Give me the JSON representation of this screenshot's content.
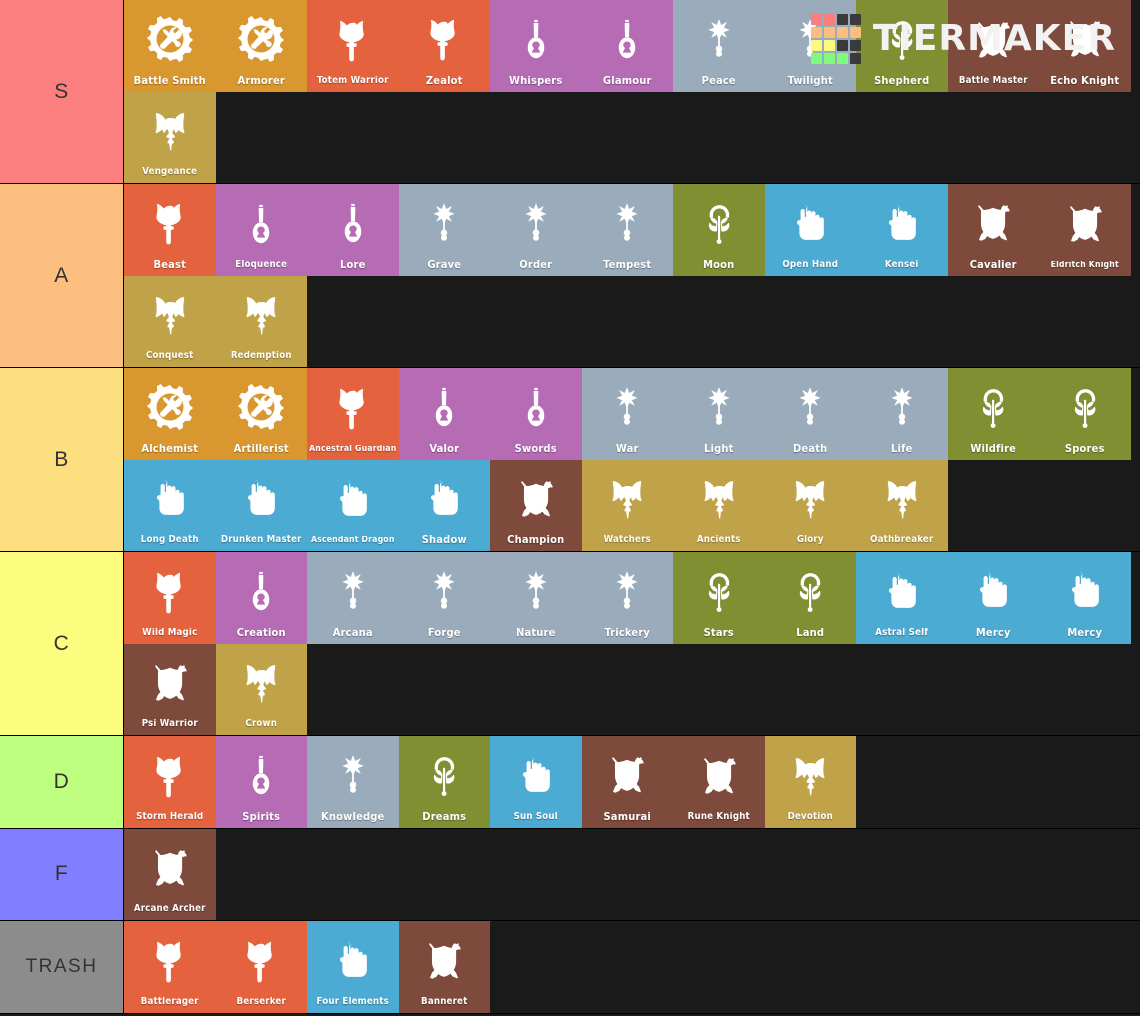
{
  "app": {
    "name": "TierMaker",
    "logo_wordmark": "TIERMAKER",
    "logo_colors": [
      "#fa7e7e",
      "#fa7e7e",
      "#3a3a3a",
      "#3a3a3a",
      "#fcbe7e",
      "#fcbe7e",
      "#fcbe7e",
      "#fcbe7e",
      "#fafa7e",
      "#fafa7e",
      "#3a3a3a",
      "#3a3a3a",
      "#7efa7e",
      "#7efa7e",
      "#7efa7e",
      "#3a3a3a"
    ]
  },
  "palette": {
    "artificer": "#d9972f",
    "barbarian": "#e4633e",
    "bard": "#b56cb5",
    "cleric": "#9aacbc",
    "druid": "#7f8f32",
    "monk": "#4cabd2",
    "fighter": "#7d4a3b",
    "paladin": "#c0a348",
    "tier_s": "#fc7f7f",
    "tier_a": "#fcbf7f",
    "tier_b": "#fcdf7f",
    "tier_c": "#fcfc7f",
    "tier_d": "#bfff7f",
    "tier_f": "#7f7fff",
    "tier_trash": "#8c8c8c",
    "background": "#1a1a1a"
  },
  "tiers": [
    {
      "label": "S",
      "color": "#fc7f7f",
      "items": [
        {
          "name": "Battle Smith",
          "cls": "artificer",
          "icon": "gear-wrench-icon",
          "size": "s1"
        },
        {
          "name": "Armorer",
          "cls": "artificer",
          "icon": "gear-wrench-icon",
          "size": "s1"
        },
        {
          "name": "Totem Warrior",
          "cls": "barbarian",
          "icon": "battleaxe-icon",
          "size": "s2"
        },
        {
          "name": "Zealot",
          "cls": "barbarian",
          "icon": "battleaxe-icon",
          "size": "s1"
        },
        {
          "name": "Whispers",
          "cls": "bard",
          "icon": "lute-icon",
          "size": "s1"
        },
        {
          "name": "Glamour",
          "cls": "bard",
          "icon": "lute-icon",
          "size": "s1"
        },
        {
          "name": "Peace",
          "cls": "cleric",
          "icon": "holy-mace-icon",
          "size": "s1"
        },
        {
          "name": "Twilight",
          "cls": "cleric",
          "icon": "holy-mace-icon",
          "size": "s1"
        },
        {
          "name": "Shepherd",
          "cls": "druid",
          "icon": "druid-staff-icon",
          "size": "s1"
        },
        {
          "name": "Battle Master",
          "cls": "fighter",
          "icon": "shield-axe-sword-icon",
          "size": "s2"
        },
        {
          "name": "Echo Knight",
          "cls": "fighter",
          "icon": "shield-axe-sword-icon",
          "size": "s1"
        },
        {
          "name": "Vengeance",
          "cls": "paladin",
          "icon": "horned-helm-icon",
          "size": "s2"
        }
      ]
    },
    {
      "label": "A",
      "color": "#fcbf7f",
      "items": [
        {
          "name": "Beast",
          "cls": "barbarian",
          "icon": "battleaxe-icon",
          "size": "s1"
        },
        {
          "name": "Eloquence",
          "cls": "bard",
          "icon": "lute-icon",
          "size": "s2"
        },
        {
          "name": "Lore",
          "cls": "bard",
          "icon": "lute-icon",
          "size": "s1"
        },
        {
          "name": "Grave",
          "cls": "cleric",
          "icon": "holy-mace-icon",
          "size": "s1"
        },
        {
          "name": "Order",
          "cls": "cleric",
          "icon": "holy-mace-icon",
          "size": "s1"
        },
        {
          "name": "Tempest",
          "cls": "cleric",
          "icon": "holy-mace-icon",
          "size": "s1"
        },
        {
          "name": "Moon",
          "cls": "druid",
          "icon": "druid-staff-icon",
          "size": "s1"
        },
        {
          "name": "Open Hand",
          "cls": "monk",
          "icon": "fist-icon",
          "size": "s2"
        },
        {
          "name": "Kensei",
          "cls": "monk",
          "icon": "fist-icon",
          "size": "s2"
        },
        {
          "name": "Cavalier",
          "cls": "fighter",
          "icon": "shield-axe-sword-icon",
          "size": "s1"
        },
        {
          "name": "Eldritch Knight",
          "cls": "fighter",
          "icon": "shield-axe-sword-icon",
          "size": "s3"
        },
        {
          "name": "Conquest",
          "cls": "paladin",
          "icon": "horned-helm-icon",
          "size": "s2"
        },
        {
          "name": "Redemption",
          "cls": "paladin",
          "icon": "horned-helm-icon",
          "size": "s2"
        }
      ]
    },
    {
      "label": "B",
      "color": "#fcdf7f",
      "items": [
        {
          "name": "Alchemist",
          "cls": "artificer",
          "icon": "gear-wrench-icon",
          "size": "s1"
        },
        {
          "name": "Artillerist",
          "cls": "artificer",
          "icon": "gear-wrench-icon",
          "size": "s1"
        },
        {
          "name": "Ancestral Guardian",
          "cls": "barbarian",
          "icon": "battleaxe-icon",
          "size": "s3"
        },
        {
          "name": "Valor",
          "cls": "bard",
          "icon": "lute-icon",
          "size": "s1"
        },
        {
          "name": "Swords",
          "cls": "bard",
          "icon": "lute-icon",
          "size": "s1"
        },
        {
          "name": "War",
          "cls": "cleric",
          "icon": "holy-mace-icon",
          "size": "s1"
        },
        {
          "name": "Light",
          "cls": "cleric",
          "icon": "holy-mace-icon",
          "size": "s1"
        },
        {
          "name": "Death",
          "cls": "cleric",
          "icon": "holy-mace-icon",
          "size": "s1"
        },
        {
          "name": "Life",
          "cls": "cleric",
          "icon": "holy-mace-icon",
          "size": "s1"
        },
        {
          "name": "Wildfire",
          "cls": "druid",
          "icon": "druid-staff-icon",
          "size": "s1"
        },
        {
          "name": "Spores",
          "cls": "druid",
          "icon": "druid-staff-icon",
          "size": "s1"
        },
        {
          "name": "Long Death",
          "cls": "monk",
          "icon": "fist-icon",
          "size": "s2"
        },
        {
          "name": "Drunken Master",
          "cls": "monk",
          "icon": "fist-icon",
          "size": "s2"
        },
        {
          "name": "Ascendant Dragon",
          "cls": "monk",
          "icon": "fist-icon",
          "size": "s3"
        },
        {
          "name": "Shadow",
          "cls": "monk",
          "icon": "fist-icon",
          "size": "s1"
        },
        {
          "name": "Champion",
          "cls": "fighter",
          "icon": "shield-axe-sword-icon",
          "size": "s1"
        },
        {
          "name": "Watchers",
          "cls": "paladin",
          "icon": "horned-helm-icon",
          "size": "s2"
        },
        {
          "name": "Ancients",
          "cls": "paladin",
          "icon": "horned-helm-icon",
          "size": "s2"
        },
        {
          "name": "Glory",
          "cls": "paladin",
          "icon": "horned-helm-icon",
          "size": "s2"
        },
        {
          "name": "Oathbreaker",
          "cls": "paladin",
          "icon": "horned-helm-icon",
          "size": "s2"
        }
      ]
    },
    {
      "label": "C",
      "color": "#fcfc7f",
      "items": [
        {
          "name": "Wild Magic",
          "cls": "barbarian",
          "icon": "battleaxe-icon",
          "size": "s2"
        },
        {
          "name": "Creation",
          "cls": "bard",
          "icon": "lute-icon",
          "size": "s1"
        },
        {
          "name": "Arcana",
          "cls": "cleric",
          "icon": "holy-mace-icon",
          "size": "s1"
        },
        {
          "name": "Forge",
          "cls": "cleric",
          "icon": "holy-mace-icon",
          "size": "s1"
        },
        {
          "name": "Nature",
          "cls": "cleric",
          "icon": "holy-mace-icon",
          "size": "s1"
        },
        {
          "name": "Trickery",
          "cls": "cleric",
          "icon": "holy-mace-icon",
          "size": "s1"
        },
        {
          "name": "Stars",
          "cls": "druid",
          "icon": "druid-staff-icon",
          "size": "s1"
        },
        {
          "name": "Land",
          "cls": "druid",
          "icon": "druid-staff-icon",
          "size": "s1"
        },
        {
          "name": "Astral Self",
          "cls": "monk",
          "icon": "fist-icon",
          "size": "s2"
        },
        {
          "name": "Mercy",
          "cls": "monk",
          "icon": "fist-icon",
          "size": "s1"
        },
        {
          "name": "Mercy",
          "cls": "monk",
          "icon": "fist-icon",
          "size": "s1"
        },
        {
          "name": "Psi Warrior",
          "cls": "fighter",
          "icon": "shield-axe-sword-icon",
          "size": "s2"
        },
        {
          "name": "Crown",
          "cls": "paladin",
          "icon": "horned-helm-icon",
          "size": "s2"
        }
      ]
    },
    {
      "label": "D",
      "color": "#bfff7f",
      "items": [
        {
          "name": "Storm Herald",
          "cls": "barbarian",
          "icon": "battleaxe-icon",
          "size": "s2"
        },
        {
          "name": "Spirits",
          "cls": "bard",
          "icon": "lute-icon",
          "size": "s1"
        },
        {
          "name": "Knowledge",
          "cls": "cleric",
          "icon": "holy-mace-icon",
          "size": "s1"
        },
        {
          "name": "Dreams",
          "cls": "druid",
          "icon": "druid-staff-icon",
          "size": "s1"
        },
        {
          "name": "Sun Soul",
          "cls": "monk",
          "icon": "fist-icon",
          "size": "s2"
        },
        {
          "name": "Samurai",
          "cls": "fighter",
          "icon": "shield-axe-sword-icon",
          "size": "s1"
        },
        {
          "name": "Rune Knight",
          "cls": "fighter",
          "icon": "shield-axe-sword-icon",
          "size": "s2"
        },
        {
          "name": "Devotion",
          "cls": "paladin",
          "icon": "horned-helm-icon",
          "size": "s2"
        }
      ]
    },
    {
      "label": "F",
      "color": "#7f7fff",
      "items": [
        {
          "name": "Arcane Archer",
          "cls": "fighter",
          "icon": "shield-axe-sword-icon",
          "size": "s2"
        }
      ]
    },
    {
      "label": "TRASH",
      "color": "#8c8c8c",
      "items": [
        {
          "name": "Battlerager",
          "cls": "barbarian",
          "icon": "battleaxe-icon",
          "size": "s2"
        },
        {
          "name": "Berserker",
          "cls": "barbarian",
          "icon": "battleaxe-icon",
          "size": "s2"
        },
        {
          "name": "Four Elements",
          "cls": "monk",
          "icon": "fist-icon",
          "size": "s2"
        },
        {
          "name": "Banneret",
          "cls": "fighter",
          "icon": "shield-axe-sword-icon",
          "size": "s2"
        }
      ]
    }
  ]
}
